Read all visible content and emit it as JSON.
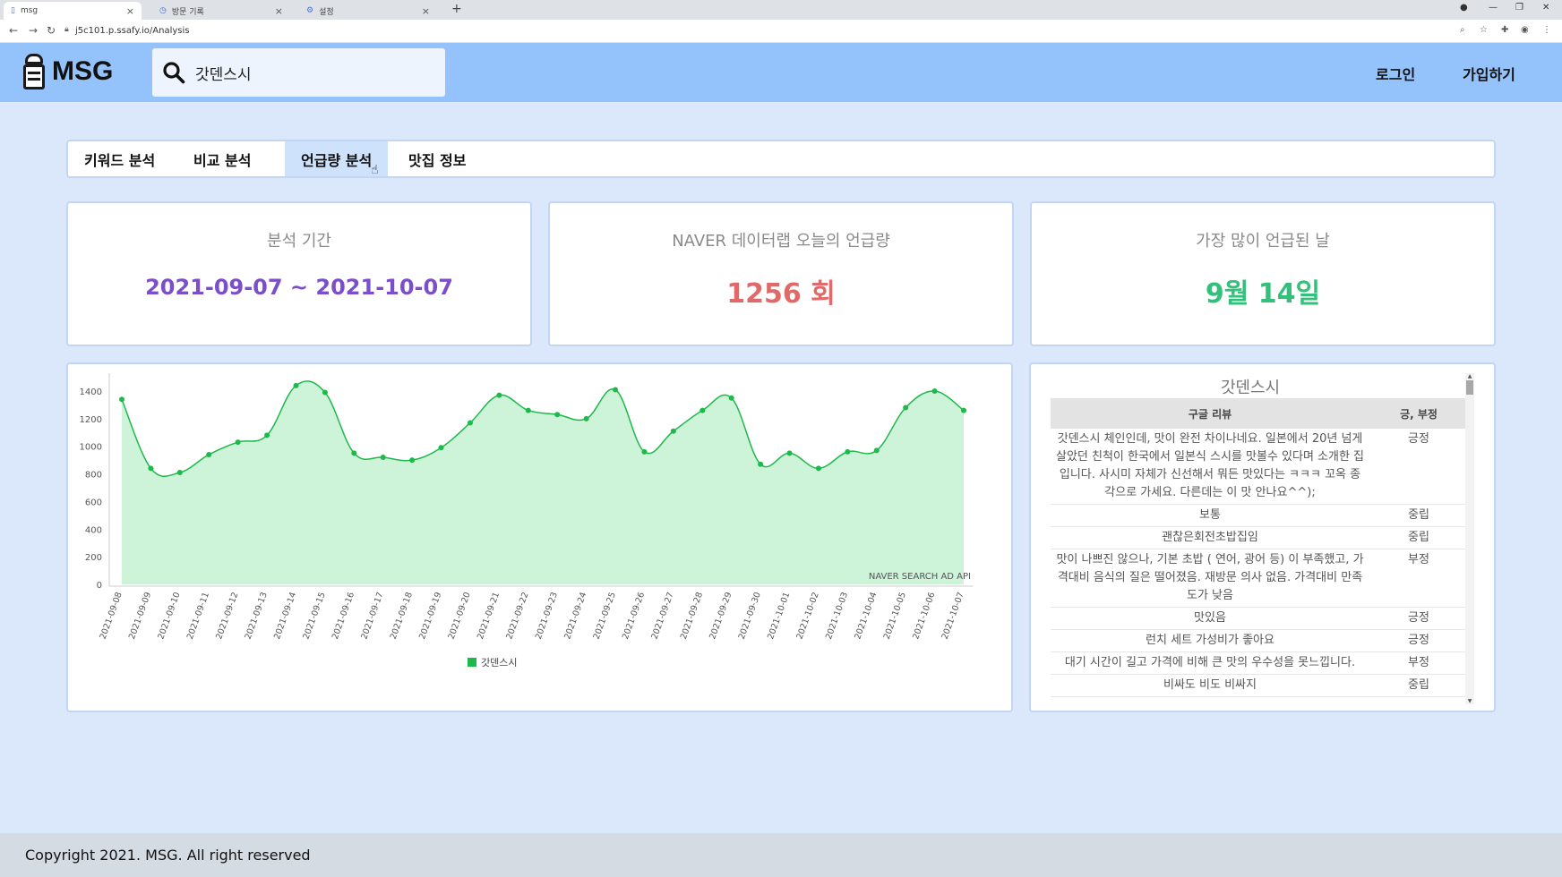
{
  "browser": {
    "tabs": [
      {
        "title": "msg",
        "icon": "page-icon",
        "active": true
      },
      {
        "title": "방문 기록",
        "icon": "history-icon",
        "active": false
      },
      {
        "title": "설정",
        "icon": "gear-icon",
        "active": false
      }
    ],
    "url": "j5c101.p.ssafy.io/Analysis"
  },
  "header": {
    "logo_text": "MSG",
    "search_value": "갓덴스시",
    "login_label": "로그인",
    "signup_label": "가입하기"
  },
  "nav": {
    "tabs": [
      "키워드 분석",
      "비교 분석",
      "언급량 분석",
      "맛집 정보"
    ],
    "active_index": 2
  },
  "cards": {
    "period": {
      "title": "분석 기간",
      "value": "2021-09-07 ~ 2021-10-07",
      "color": "#7a4fc9"
    },
    "today": {
      "title": "NAVER 데이터랩 오늘의 언급량",
      "value": "1256 회",
      "color": "#e06a6a"
    },
    "peak": {
      "title": "가장 많이 언급된 날",
      "value": "9월 14일",
      "color": "#33c07a"
    }
  },
  "chart_data": {
    "type": "area",
    "x": [
      "2021-09-08",
      "2021-09-09",
      "2021-09-10",
      "2021-09-11",
      "2021-09-12",
      "2021-09-13",
      "2021-09-14",
      "2021-09-15",
      "2021-09-16",
      "2021-09-17",
      "2021-09-18",
      "2021-09-19",
      "2021-09-20",
      "2021-09-21",
      "2021-09-22",
      "2021-09-23",
      "2021-09-24",
      "2021-09-25",
      "2021-09-26",
      "2021-09-27",
      "2021-09-28",
      "2021-09-29",
      "2021-09-30",
      "2021-10-01",
      "2021-10-02",
      "2021-10-03",
      "2021-10-04",
      "2021-10-05",
      "2021-10-06",
      "2021-10-07"
    ],
    "series": [
      {
        "name": "갓덴스시",
        "values": [
          1340,
          840,
          810,
          940,
          1030,
          1080,
          1440,
          1390,
          950,
          920,
          900,
          990,
          1170,
          1370,
          1260,
          1230,
          1200,
          1410,
          960,
          1110,
          1260,
          1350,
          870,
          950,
          840,
          960,
          970,
          1280,
          1400,
          1260
        ],
        "color": "#1db94a",
        "fill": "#cdf3d8"
      }
    ],
    "ylim": [
      0,
      1400
    ],
    "yticks": [
      0,
      200,
      400,
      600,
      800,
      1000,
      1200,
      1400
    ],
    "annotation": "NAVER SEARCH AD API",
    "legend_position": "bottom",
    "grid": false
  },
  "reviews": {
    "title": "갓덴스시",
    "col_review": "구글 리뷰",
    "col_sentiment": "긍, 부정",
    "rows": [
      {
        "text": "갓덴스시 체인인데, 맛이 완전 차이나네요. 일본에서 20년 넘게 살았던 친척이 한국에서 일본식 스시를 맛볼수 있다며 소개한 집입니다. 사시미 자체가 신선해서 뭐든 맛있다는 ㅋㅋㅋ 꼬옥 종각으로 가세요. 다른데는 이 맛 안나요^^);",
        "sentiment": "긍정",
        "kind": "pos"
      },
      {
        "text": "보통",
        "sentiment": "중립",
        "kind": "neu"
      },
      {
        "text": "괜찮은회전초밥집임",
        "sentiment": "중립",
        "kind": "neu"
      },
      {
        "text": "맛이 나쁘진 않으나, 기본 초밥 ( 연어, 광어 등) 이 부족했고, 가격대비 음식의 질은 떨어졌음. 재방문 의사 없음. 가격대비 만족도가 낮음",
        "sentiment": "부정",
        "kind": "neg"
      },
      {
        "text": "맛있음",
        "sentiment": "긍정",
        "kind": "pos"
      },
      {
        "text": "런치 세트 가성비가 좋아요",
        "sentiment": "긍정",
        "kind": "pos"
      },
      {
        "text": "대기 시간이 길고 가격에 비해 큰 맛의 우수성을 못느낍니다.",
        "sentiment": "부정",
        "kind": "neg"
      },
      {
        "text": "비싸도 비도 비싸지",
        "sentiment": "중립",
        "kind": "neu"
      }
    ]
  },
  "footer": {
    "copyright": "Copyright 2021. MSG. All right reserved"
  }
}
